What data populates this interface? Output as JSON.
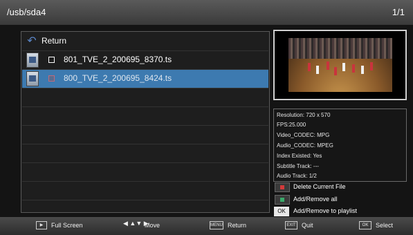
{
  "header": {
    "path": "/usb/sda4",
    "page": "1/1"
  },
  "filelist": {
    "return_label": "Return",
    "files": [
      {
        "name": "801_TVE_2_200695_8370.ts"
      },
      {
        "name": "800_TVE_2_200695_8424.ts"
      }
    ]
  },
  "info": {
    "resolution": "Resolution: 720 x 570",
    "fps": "FPS:25.000",
    "video_codec": "Video_CODEC: MPG",
    "audio_codec": "Audio_CODEC: MPEG",
    "index": "Index Existed: Yes",
    "subtitle": "Subtitle Track: ---",
    "audio_track": "Audio Track: 1/2"
  },
  "legend": {
    "delete": "Delete Current File",
    "add_all": "Add/Remove all",
    "add_playlist": "Add/Remove to playlist",
    "ok_key": "OK"
  },
  "bottom": {
    "fullscreen": "Full Screen",
    "move": "Move",
    "return": "Return",
    "quit": "Quit",
    "select": "Select",
    "menu_key": "MENU",
    "exit_key": "EXIT",
    "ok_key": "OK"
  },
  "colors": {
    "red": "#d33a3a",
    "green": "#3aaa6a",
    "selection": "#3d7ab0"
  },
  "icons": [
    "return-icon",
    "file-icon",
    "checkbox",
    "play-icon",
    "arrow-icons",
    "menu-key",
    "exit-key",
    "ok-key"
  ]
}
